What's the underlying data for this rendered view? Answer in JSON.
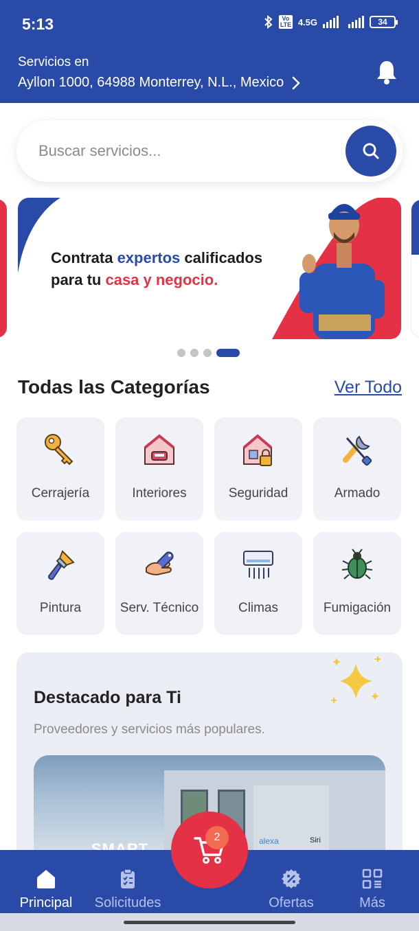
{
  "status_bar": {
    "time": "5:13",
    "network_label": "4.5G",
    "volte_label": "Vo LTE",
    "battery": "34"
  },
  "header": {
    "label": "Servicios en",
    "address": "Ayllon 1000, 64988 Monterrey, N.L., Mexico"
  },
  "search": {
    "placeholder": "Buscar servicios..."
  },
  "banner": {
    "line1_a": "Contrata ",
    "line1_b": "expertos",
    "line1_c": " calificados",
    "line2_a": "para tu ",
    "line2_b": "casa y negocio."
  },
  "carousel": {
    "count": 4,
    "active": 4
  },
  "categories": {
    "title": "Todas las Categorías",
    "see_all": "Ver Todo",
    "items": [
      {
        "label": "Cerrajería",
        "icon": "key-icon"
      },
      {
        "label": "Interiores",
        "icon": "house-interior-icon"
      },
      {
        "label": "Seguridad",
        "icon": "house-lock-icon"
      },
      {
        "label": "Armado",
        "icon": "tools-icon"
      },
      {
        "label": "Pintura",
        "icon": "paintbrush-icon"
      },
      {
        "label": "Serv. Técnico",
        "icon": "wrench-hand-icon"
      },
      {
        "label": "Climas",
        "icon": "air-conditioner-icon"
      },
      {
        "label": "Fumigación",
        "icon": "bug-icon"
      }
    ]
  },
  "featured": {
    "title": "Destacado para Ti",
    "subtitle": "Proveedores y servicios más populares.",
    "image_text": "SMART",
    "alexa": "alexa",
    "siri": "Siri"
  },
  "nav": {
    "items": [
      {
        "label": "Principal",
        "icon": "home-icon",
        "active": true
      },
      {
        "label": "Solicitudes",
        "icon": "clipboard-icon",
        "active": false
      },
      {
        "label": "Ofertas",
        "icon": "discount-icon",
        "active": false
      },
      {
        "label": "Más",
        "icon": "grid-icon",
        "active": false
      }
    ],
    "cart_count": "2"
  },
  "colors": {
    "primary": "#2a4aa8",
    "accent": "#e43145",
    "card": "#f1f2f8"
  }
}
